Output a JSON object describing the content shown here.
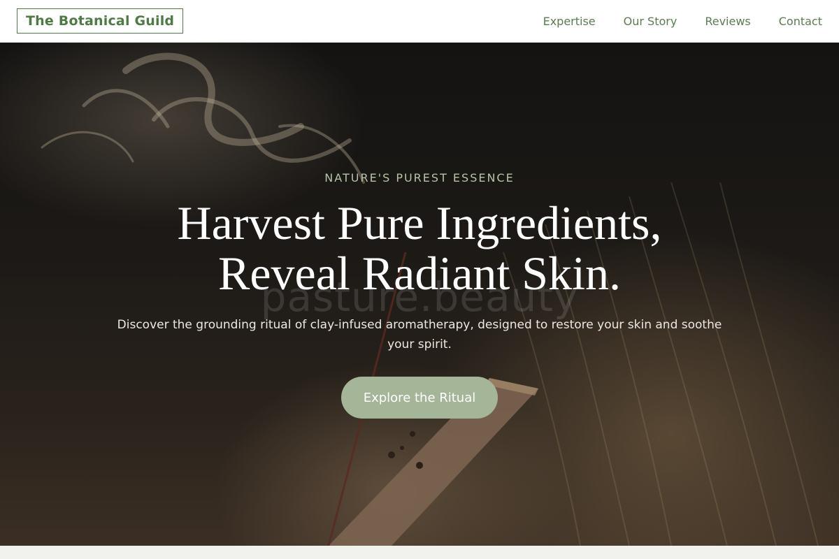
{
  "header": {
    "logo_text": "The Botanical Guild",
    "nav": [
      {
        "label": "Expertise"
      },
      {
        "label": "Our Story"
      },
      {
        "label": "Reviews"
      },
      {
        "label": "Contact"
      }
    ]
  },
  "hero": {
    "eyebrow": "NATURE'S PUREST ESSENCE",
    "headline_line1": "Harvest Pure Ingredients,",
    "headline_line2": "Reveal Radiant Skin.",
    "subtitle": "Discover the grounding ritual of clay-infused aromatherapy, designed to restore your skin and soothe your spirit.",
    "cta_label": "Explore the Ritual",
    "watermark": "pasture.beauty"
  },
  "colors": {
    "brand_green": "#4f7a45",
    "nav_green": "#5b7c52",
    "cta_sage": "#a5b597",
    "eyebrow_sage": "#b7c4a8"
  }
}
